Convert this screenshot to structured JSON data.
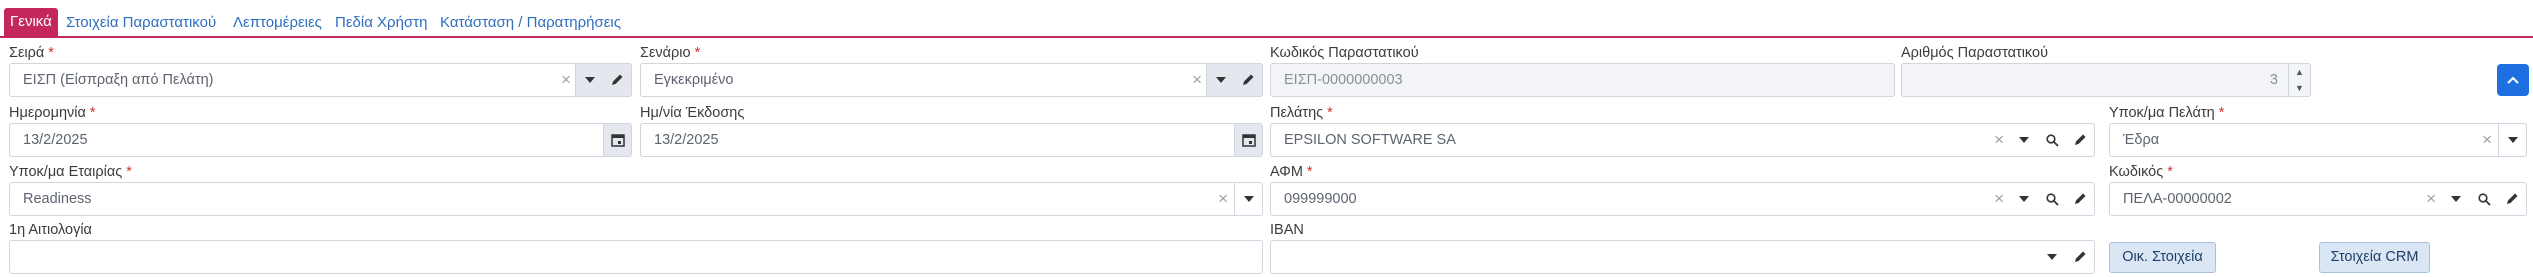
{
  "tabs": [
    {
      "label": "Γενικά",
      "active": true
    },
    {
      "label": "Στοιχεία Παραστατικού"
    },
    {
      "label": "Λεπτομέρειες"
    },
    {
      "label": "Πεδία Χρήστη"
    },
    {
      "label": "Κατάσταση / Παρατηρήσεις"
    }
  ],
  "required_mark": "*",
  "fields": {
    "series": {
      "label": "Σειρά",
      "value": "ΕΙΣΠ (Είσπραξη από Πελάτη)"
    },
    "scenario": {
      "label": "Σενάριο",
      "value": "Εγκεκριμένο"
    },
    "doc_code": {
      "label": "Κωδικός Παραστατικού",
      "value": "ΕΙΣΠ-0000000003"
    },
    "doc_number": {
      "label": "Αριθμός Παραστατικού",
      "value": "3"
    },
    "date": {
      "label": "Ημερομηνία",
      "value": "13/2/2025"
    },
    "issue_date": {
      "label": "Ημ/νία Έκδοσης",
      "value": "13/2/2025"
    },
    "customer": {
      "label": "Πελάτης",
      "value": "EPSILON SOFTWARE SA"
    },
    "customer_branch": {
      "label": "Υποκ/μα Πελάτη",
      "value": "Έδρα"
    },
    "company_branch": {
      "label": "Υποκ/μα Εταιρίας",
      "value": "Readiness"
    },
    "vat": {
      "label": "ΑΦΜ",
      "value": "099999000"
    },
    "code": {
      "label": "Κωδικός",
      "value": "ΠΕΛΑ-00000002"
    },
    "reason": {
      "label": "1η Αιτιολογία",
      "value": ""
    },
    "iban": {
      "label": "IBAN",
      "value": ""
    }
  },
  "buttons": {
    "financial": "Οικ. Στοιχεία",
    "crm": "Στοιχεία CRM"
  },
  "colors": {
    "accent": "#c3275d",
    "primary": "#1e6fe0",
    "required": "#d0342c"
  }
}
